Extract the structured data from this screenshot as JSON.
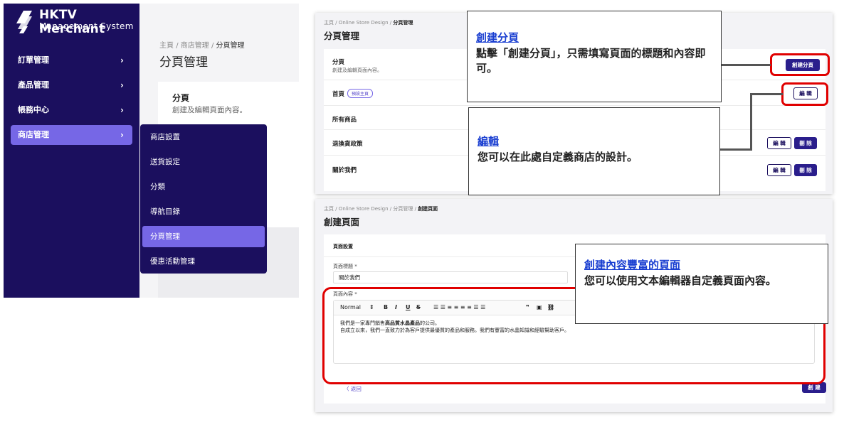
{
  "brand": {
    "name": "HKTV Merchant",
    "subtitle": "Management System"
  },
  "sidebar": {
    "items": [
      {
        "label": "訂單管理",
        "chevron": "›"
      },
      {
        "label": "產品管理",
        "chevron": "›"
      },
      {
        "label": "帳務中心",
        "chevron": "›"
      },
      {
        "label": "商店管理",
        "chevron": "›"
      }
    ]
  },
  "panel1": {
    "breadcrumb": [
      "主頁",
      "商店管理",
      "分頁管理"
    ],
    "separator": "/",
    "title": "分頁管理",
    "card_title": "分頁",
    "card_subtitle": "創建及編輯頁面內容。"
  },
  "dropdown": {
    "items": [
      "商店設置",
      "送貨設定",
      "分類",
      "導航目錄",
      "分頁管理",
      "優惠活動管理"
    ]
  },
  "panel2": {
    "breadcrumb": [
      "主頁",
      "Online Store Design",
      "分頁管理"
    ],
    "title": "分頁管理",
    "header_label": "分頁",
    "header_subtitle": "創建及編輯頁面內容。",
    "create_button": "創建分頁",
    "rows": [
      {
        "label": "首頁",
        "badge": "預設主頁",
        "edit": "編 輯"
      },
      {
        "label": "所有商品"
      },
      {
        "label": "退換貨政策",
        "edit": "編 輯",
        "delete": "刪 除"
      },
      {
        "label": "關於我們",
        "edit": "編 輯",
        "delete": "刪 除"
      }
    ]
  },
  "panel3": {
    "breadcrumb": [
      "主頁",
      "Online Store Design",
      "分頁管理",
      "創建頁面"
    ],
    "title": "創建頁面",
    "section": "頁面設置",
    "title_label": "頁面標題 *",
    "title_value": "關於我們",
    "content_label": "頁面內容 *",
    "toolbar": {
      "format": "Normal",
      "format_arrow": "⇕",
      "bold": "B",
      "italic": "I",
      "underline": "U",
      "strike": "S",
      "lists": "☰ ☰ ≡ ≡ ≡ ≡ ☰ ☰",
      "quote": "❞",
      "image": "▣",
      "link": "⛓"
    },
    "content_line1_pre": "我們是一家專門銷售",
    "content_line1_bold": "高品質水晶產品",
    "content_line1_post": "的公司。",
    "content_line2": "自成立以來，我們一直致力於為客戶提供最優質的產品和服務。我們有豐富的水晶知識和經驗幫助客戶。",
    "back": "〈 返回",
    "create_button": "創 建"
  },
  "callouts": {
    "create": {
      "title": "創建分頁",
      "body": "點擊「創建分頁」，只需填寫頁面的標題和內容即可。"
    },
    "edit": {
      "title": "編輯",
      "body": "您可以在此處自定義商店的設計。"
    },
    "rich": {
      "title": "創建內容豐富的頁面",
      "body": "您可以使用文本編輯器自定義頁面內容。"
    }
  },
  "colors": {
    "sidebar_bg": "#1b0f5e",
    "accent": "#7667e6",
    "callout_title": "#1a3fd1",
    "highlight_red": "#e00000"
  }
}
